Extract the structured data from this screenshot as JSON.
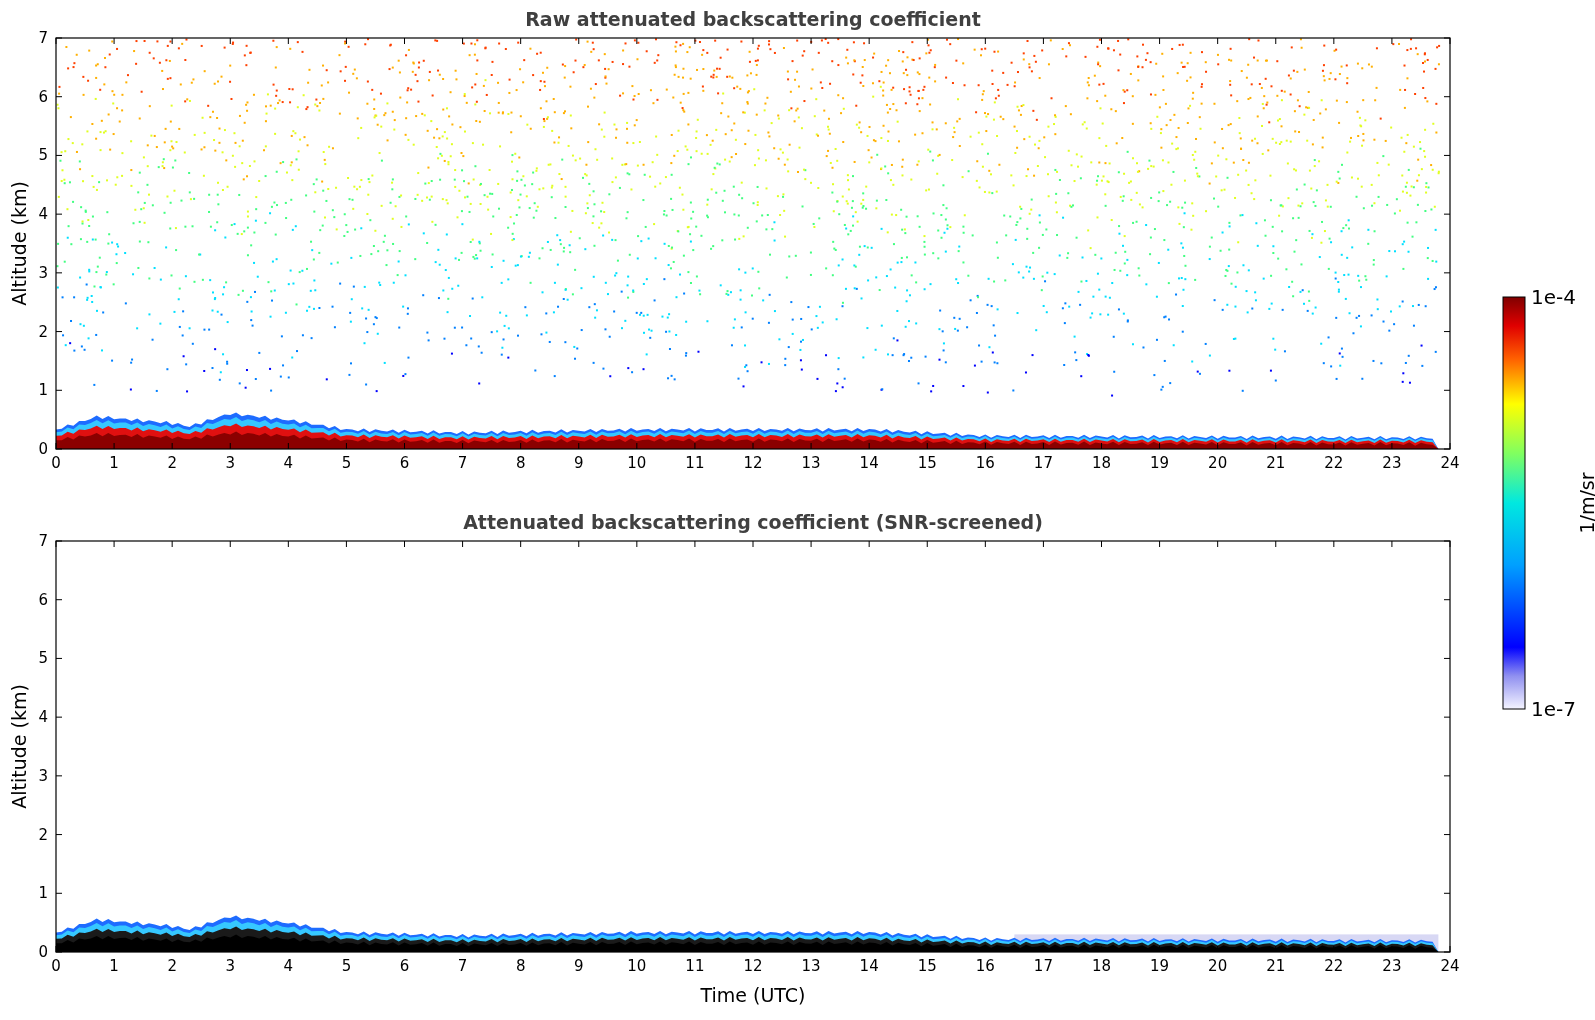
{
  "panels": [
    {
      "kind": "raw",
      "title": "Raw attenuated backscattering coefficient",
      "ylabel": "Altitude (km)",
      "yticks": [
        "7",
        "6",
        "5",
        "4",
        "3",
        "2",
        "1",
        "0"
      ],
      "xticks": [
        "0",
        "1",
        "2",
        "3",
        "4",
        "5",
        "6",
        "7",
        "8",
        "9",
        "10",
        "11",
        "12",
        "13",
        "14",
        "15",
        "16",
        "17",
        "18",
        "19",
        "20",
        "21",
        "22",
        "23",
        "24"
      ]
    },
    {
      "kind": "screened",
      "title": "Attenuated backscattering coefficient (SNR-screened)",
      "ylabel": "Altitude (km)",
      "yticks": [
        "7",
        "6",
        "5",
        "4",
        "3",
        "2",
        "1",
        "0"
      ],
      "xticks": [
        "0",
        "1",
        "2",
        "3",
        "4",
        "5",
        "6",
        "7",
        "8",
        "9",
        "10",
        "11",
        "12",
        "13",
        "14",
        "15",
        "16",
        "17",
        "18",
        "19",
        "20",
        "21",
        "22",
        "23",
        "24"
      ]
    }
  ],
  "xlabel": "Time (UTC)",
  "colorbar": {
    "label": "1/m/sr",
    "max": "1e-4",
    "min": "1e-7"
  }
}
